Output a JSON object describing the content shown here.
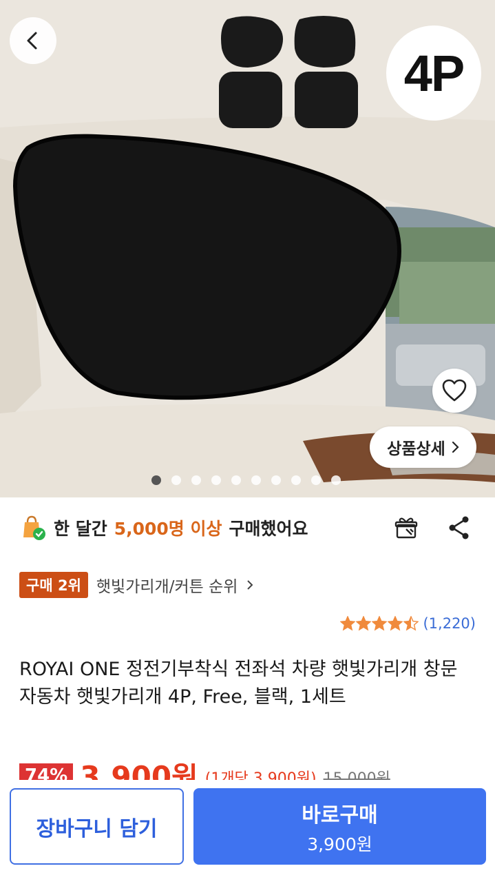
{
  "hero": {
    "badge_text": "4P",
    "detail_label": "상품상세",
    "slide_count": 10,
    "active_slide": 1
  },
  "social_proof": {
    "prefix": "한 달간",
    "highlight": "5,000명 이상",
    "suffix": "구매했어요"
  },
  "rank": {
    "badge": "구매 2위",
    "category": "햇빛가리개/커튼 순위"
  },
  "rating": {
    "stars": 4.5,
    "count": "(1,220)"
  },
  "product": {
    "title": "ROYAI ONE 정전기부착식 전좌석 차량 햇빛가리개 창문 자동차 햇빛가리개 4P, Free, 블랙, 1세트"
  },
  "price": {
    "discount": "74%",
    "sale": "3,900원",
    "unit": "(1개당 3,900원)",
    "original": "15,000원"
  },
  "bottom_bar": {
    "cart_label": "장바구니 담기",
    "buy_label": "바로구매",
    "buy_price": "3,900원"
  },
  "colors": {
    "accent_blue": "#3f73f0",
    "sale_red": "#e63a1d",
    "rank_orange": "#cc4e15",
    "highlight_orange": "#d9661a",
    "star": "#f08a3c"
  }
}
